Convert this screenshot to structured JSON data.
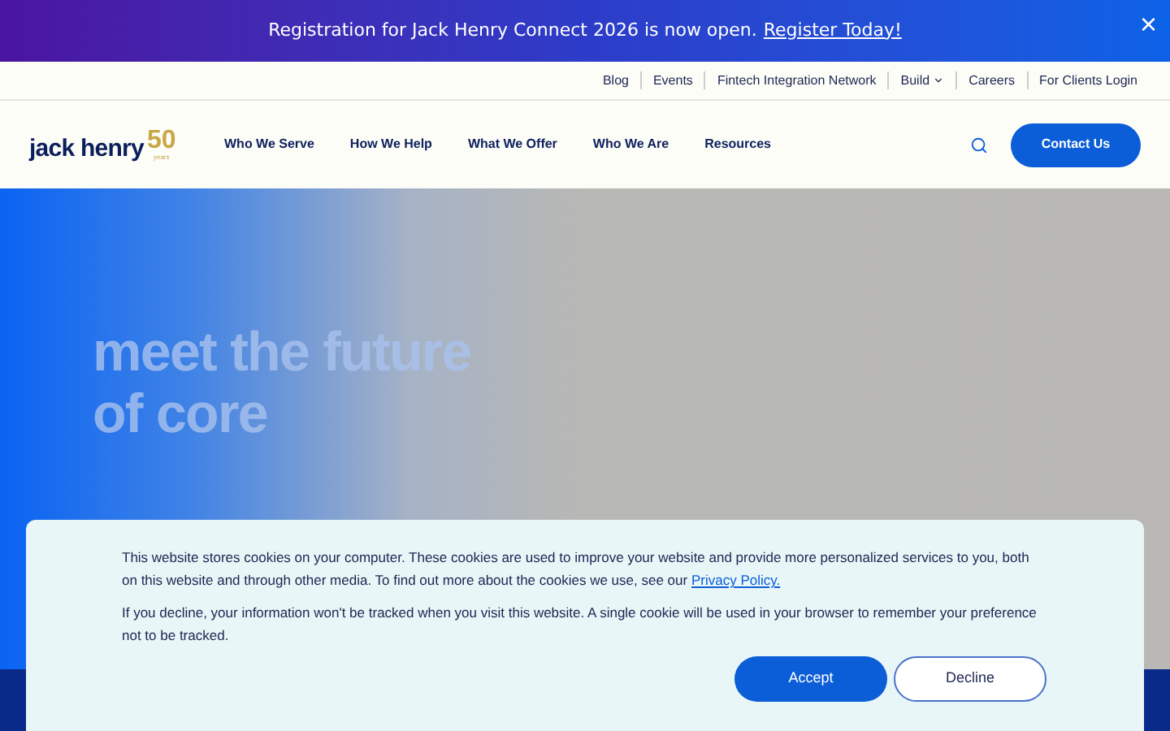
{
  "announcement": {
    "text": "Registration for Jack Henry Connect 2026 is now open.",
    "link": "Register Today!",
    "close": "×"
  },
  "utility_nav": [
    {
      "label": "Blog",
      "dropdown": false
    },
    {
      "label": "Events",
      "dropdown": false
    },
    {
      "label": "Fintech Integration Network",
      "dropdown": false
    },
    {
      "label": "Build",
      "dropdown": true
    },
    {
      "label": "Careers",
      "dropdown": false
    },
    {
      "label": "For Clients Login",
      "dropdown": false
    }
  ],
  "logo": {
    "text": "jack henry",
    "badge": "50",
    "badge_caption": "years"
  },
  "main_nav": [
    "Who We Serve",
    "How We Help",
    "What We Offer",
    "Who We Are",
    "Resources"
  ],
  "contact_button": "Contact Us",
  "hero": {
    "heading_lines": [
      "meet the future",
      "of core"
    ]
  },
  "cookie_banner": {
    "paragraphs": [
      "This website stores cookies on your computer. These cookies are used to improve your website and provide more personalized services to you, both on this website and through other media. To find out more about the cookies we use, see our",
      "If you decline, your information won't be tracked when you visit this website. A single cookie will be used in your browser to remember your preference not to be tracked."
    ],
    "link": "Privacy Policy.",
    "accept": "Accept",
    "decline": "Decline"
  }
}
